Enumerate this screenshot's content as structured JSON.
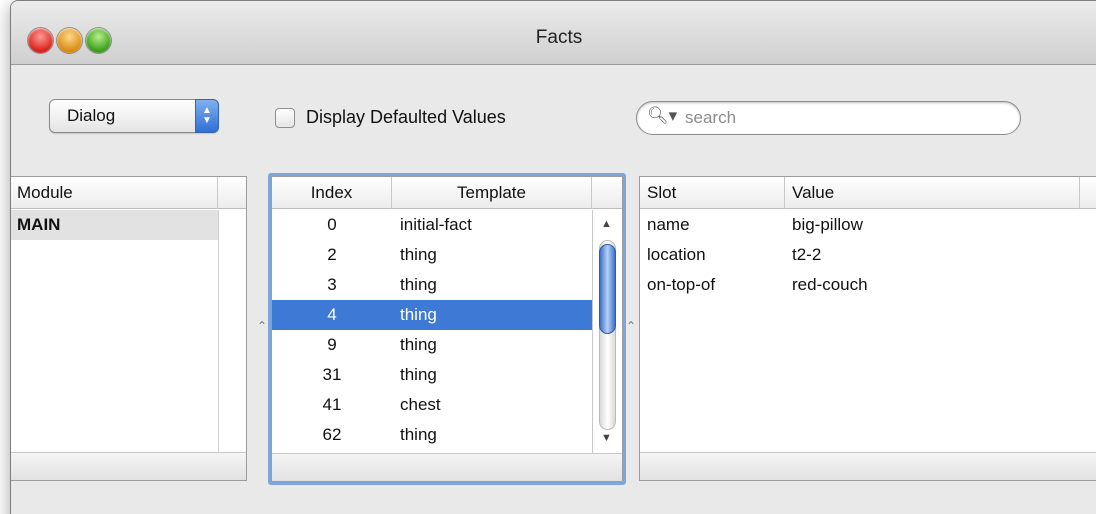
{
  "window": {
    "title": "Facts"
  },
  "toolbar": {
    "popup_value": "Dialog",
    "checkbox_label": "Display Defaulted Values",
    "checkbox_checked": false,
    "search_placeholder": "search"
  },
  "module_table": {
    "headers": [
      "Module"
    ],
    "rows": [
      "MAIN"
    ]
  },
  "facts_table": {
    "headers": [
      "Index",
      "Template"
    ],
    "rows": [
      {
        "index": "0",
        "template": "initial-fact"
      },
      {
        "index": "2",
        "template": "thing"
      },
      {
        "index": "3",
        "template": "thing"
      },
      {
        "index": "4",
        "template": "thing",
        "selected": true
      },
      {
        "index": "9",
        "template": "thing"
      },
      {
        "index": "31",
        "template": "thing"
      },
      {
        "index": "41",
        "template": "chest"
      },
      {
        "index": "62",
        "template": "thing"
      }
    ]
  },
  "slot_table": {
    "headers": [
      "Slot",
      "Value"
    ],
    "rows": [
      {
        "slot": "name",
        "value": "big-pillow"
      },
      {
        "slot": "location",
        "value": "t2-2"
      },
      {
        "slot": "on-top-of",
        "value": "red-couch"
      }
    ]
  },
  "colors": {
    "selection": "#3e79d6",
    "focus": "#7ea6dc"
  }
}
